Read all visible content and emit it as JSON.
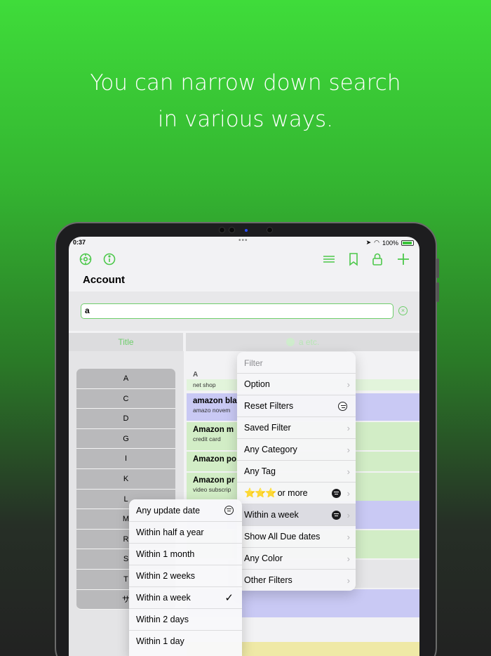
{
  "headline": {
    "line1": "You can narrow down search",
    "line2": "in various ways."
  },
  "status": {
    "time": "0:37",
    "battery": "100%"
  },
  "toolbar": {
    "left_icons": [
      "settings-icon",
      "info-icon"
    ],
    "right_icons": [
      "menu-lines-icon",
      "bookmark-icon",
      "lock-icon",
      "plus-icon"
    ]
  },
  "page": {
    "title": "Account"
  },
  "search": {
    "value": "a"
  },
  "columns": {
    "left": "Title",
    "right": "a etc."
  },
  "index": [
    "A",
    "C",
    "D",
    "G",
    "I",
    "K",
    "L",
    "M",
    "R",
    "S",
    "T",
    "サ"
  ],
  "list": {
    "section": "A",
    "rows": [
      {
        "title": "",
        "sub": "net shop",
        "color": "#e2f4db"
      },
      {
        "title": "amazon bla",
        "sub": "amazo novem",
        "color": "#c9c9f4"
      },
      {
        "title": "Amazon m",
        "sub": "credit card",
        "color": "#d2edc6"
      },
      {
        "title": "Amazon po",
        "sub": "",
        "color": "#d2edc6"
      },
      {
        "title": "Amazon pr",
        "sub": "video subscrip",
        "color": "#d2edc6"
      },
      {
        "title": "",
        "sub": "",
        "color": "#c9c9f4"
      },
      {
        "title": "",
        "sub": "",
        "color": "#d2edc6"
      },
      {
        "title": "",
        "sub": "",
        "color": "#e6e6e8"
      },
      {
        "title": "",
        "sub": "",
        "color": "#c9c9f4"
      },
      {
        "title": "",
        "sub": "",
        "color": "#efe9a6"
      }
    ]
  },
  "filter_menu": {
    "title": "Filter",
    "items": [
      {
        "label": "Option"
      },
      {
        "label": "Reset Filters"
      },
      {
        "label": "Saved Filter"
      },
      {
        "label": "Any Category"
      },
      {
        "label": "Any Tag"
      },
      {
        "label": "or more",
        "stars": "⭐⭐⭐"
      },
      {
        "label": "Within a week"
      },
      {
        "label": "Show All Due dates"
      },
      {
        "label": "Any Color"
      },
      {
        "label": "Other Filters"
      }
    ]
  },
  "update_submenu": {
    "items": [
      {
        "label": "Any update date"
      },
      {
        "label": "Within half a year"
      },
      {
        "label": "Within 1 month"
      },
      {
        "label": "Within 2 weeks"
      },
      {
        "label": "Within a week",
        "checked": true
      },
      {
        "label": "Within 2 days"
      },
      {
        "label": "Within 1 day"
      }
    ],
    "check_mark": "✓"
  }
}
